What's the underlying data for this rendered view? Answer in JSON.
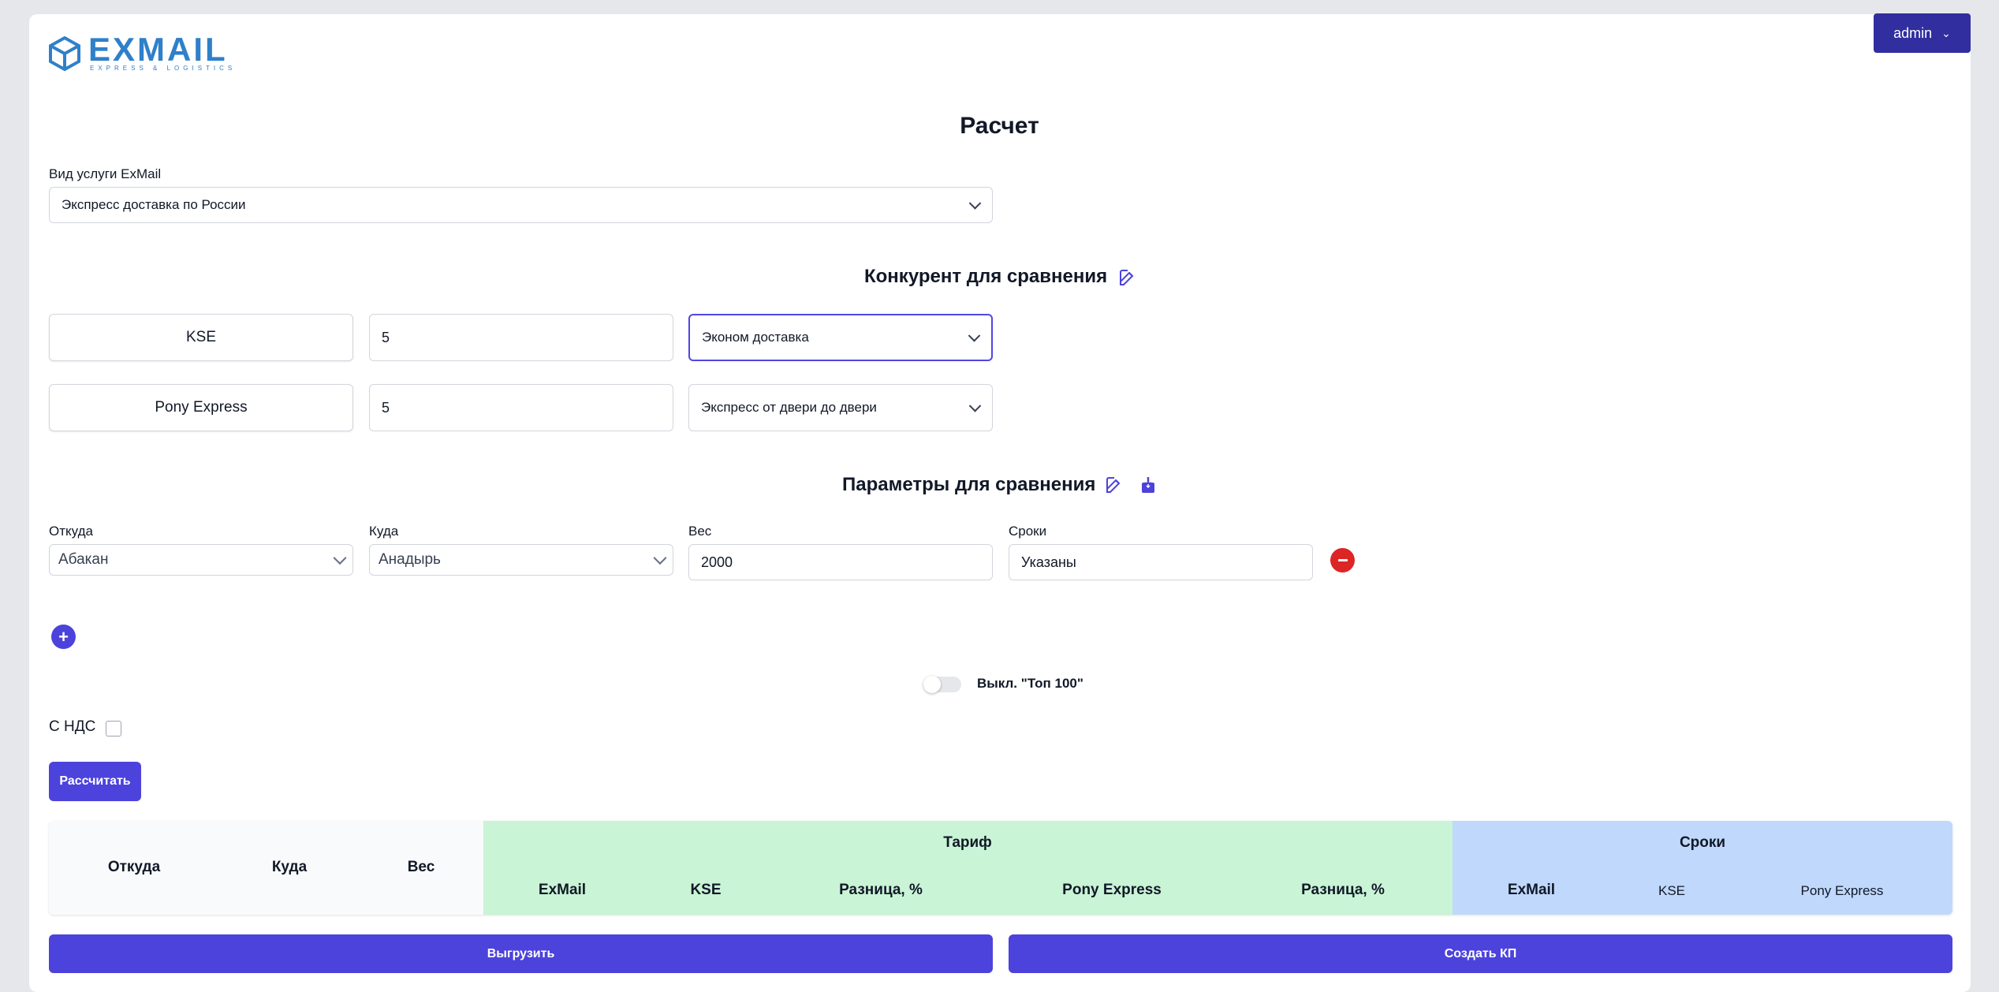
{
  "brand": {
    "name": "EXMAIL",
    "tagline": "EXPRESS & LOGISTICS",
    "color": "#2f80c9"
  },
  "user_menu": {
    "label": "admin"
  },
  "page": {
    "title": "Расчет"
  },
  "service": {
    "label": "Вид услуги ExMail",
    "value": "Экспресс доставка по России"
  },
  "competitors": {
    "title": "Конкурент для сравнения",
    "rows": [
      {
        "name": "KSE",
        "value": "5",
        "service": "Эконом доставка"
      },
      {
        "name": "Pony Express",
        "value": "5",
        "service": "Экспресс от двери до двери"
      }
    ]
  },
  "params": {
    "title": "Параметры для сравнения",
    "from_label": "Откуда",
    "from_value": "Абакан",
    "to_label": "Куда",
    "to_value": "Анадырь",
    "weight_label": "Вес",
    "weight_value": "2000",
    "terms_label": "Сроки",
    "terms_value": "Указаны"
  },
  "top100": {
    "label": "Выкл. \"Топ 100\""
  },
  "vat": {
    "label": "С НДС"
  },
  "calculate_label": "Рассчитать",
  "table": {
    "col_from": "Откуда",
    "col_to": "Куда",
    "col_weight": "Вес",
    "tariff_group": "Тариф",
    "tariff_cols": [
      "ExMail",
      "KSE",
      "Разница, %",
      "Pony Express",
      "Разница, %"
    ],
    "terms_group": "Сроки",
    "terms_cols": [
      "ExMail",
      "KSE",
      "Pony Express"
    ]
  },
  "export_label": "Выгрузить",
  "create_offer_label": "Создать КП",
  "colors": {
    "accent": "#4c43dc",
    "admin": "#312e9f",
    "danger": "#dc2626",
    "tariff_bg": "#c9f4d6",
    "terms_bg": "#c0d8fb"
  }
}
